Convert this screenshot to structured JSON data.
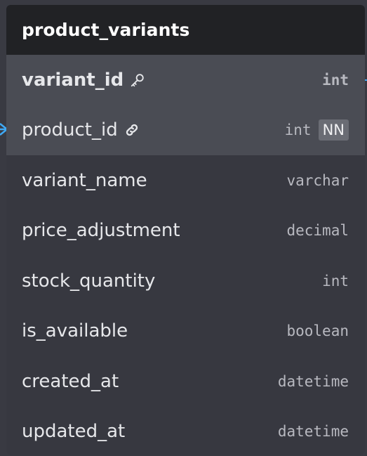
{
  "table": {
    "title": "product_variants",
    "rows": [
      {
        "name": "variant_id",
        "type": "int",
        "primary_key": true,
        "foreign_key": false,
        "not_null": false
      },
      {
        "name": "product_id",
        "type": "int",
        "primary_key": false,
        "foreign_key": true,
        "not_null": true,
        "nn_label": "NN"
      },
      {
        "name": "variant_name",
        "type": "varchar"
      },
      {
        "name": "price_adjustment",
        "type": "decimal"
      },
      {
        "name": "stock_quantity",
        "type": "int"
      },
      {
        "name": "is_available",
        "type": "boolean"
      },
      {
        "name": "created_at",
        "type": "datetime"
      },
      {
        "name": "updated_at",
        "type": "datetime"
      }
    ]
  },
  "colors": {
    "header_bg": "#212225",
    "body_bg": "#373840",
    "key_row_bg": "#4a4c54",
    "connector": "#3fa9f5"
  },
  "icons": {
    "primary_key": "key-icon",
    "foreign_key": "link-icon"
  }
}
